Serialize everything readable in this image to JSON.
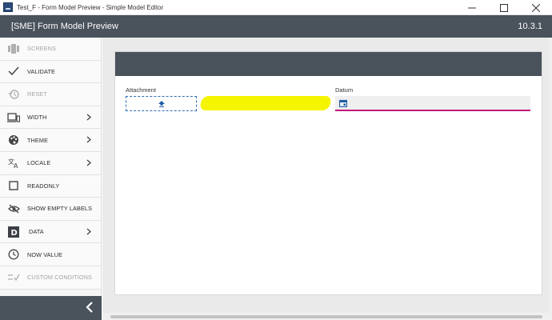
{
  "window": {
    "title": "Test_F - Form Model Preview - Simple Model Editor"
  },
  "appbar": {
    "title": "[SME] Form Model Preview",
    "version": "10.3.1"
  },
  "sidebar": {
    "items": [
      {
        "label": "SCREENS",
        "icon": "screens-icon",
        "disabled": true,
        "chevron": false
      },
      {
        "label": "VALIDATE",
        "icon": "check-icon",
        "disabled": false,
        "chevron": false
      },
      {
        "label": "RESET",
        "icon": "history-icon",
        "disabled": true,
        "chevron": false
      },
      {
        "label": "WIDTH",
        "icon": "devices-icon",
        "disabled": false,
        "chevron": true
      },
      {
        "label": "THEME",
        "icon": "palette-icon",
        "disabled": false,
        "chevron": true
      },
      {
        "label": "LOCALE",
        "icon": "translate-icon",
        "disabled": false,
        "chevron": true
      },
      {
        "label": "READONLY",
        "icon": "checkbox-icon",
        "disabled": false,
        "chevron": false
      },
      {
        "label": "SHOW EMPTY LABELS",
        "icon": "eye-off-icon",
        "disabled": false,
        "chevron": false
      },
      {
        "label": "DATA",
        "icon": "data-d-icon",
        "disabled": false,
        "chevron": true
      },
      {
        "label": "NOW VALUE",
        "icon": "clock-icon",
        "disabled": false,
        "chevron": false
      },
      {
        "label": "CUSTOM CONDITIONS",
        "icon": "conditions-icon",
        "disabled": true,
        "chevron": false
      }
    ],
    "data_icon_letter": "D"
  },
  "form": {
    "attachment_label": "Attachment",
    "date_label": "Datum"
  },
  "colors": {
    "appbar": "#4a525c",
    "accent_underline": "#c2187a",
    "attach_border": "#2e6db4",
    "redaction": "#f5f500"
  }
}
